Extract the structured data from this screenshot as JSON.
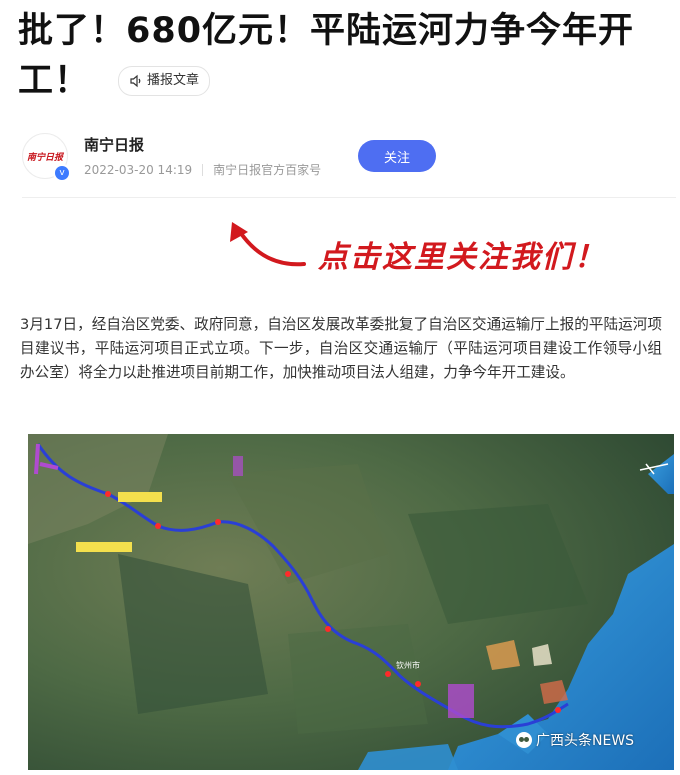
{
  "article": {
    "title_line1": "批了！680亿元！平陆运河力争今年开",
    "title_line2": "工！",
    "listen_label": "播报文章"
  },
  "author": {
    "name": "南宁日报",
    "avatar_text": "南宁日报",
    "date": "2022-03-20 14:19",
    "source": "南宁日报官方百家号",
    "follow_label": "关注",
    "verified_mark": "v"
  },
  "banner": {
    "text": "点击这里关注我们！"
  },
  "body": {
    "paragraph": "3月17日，经自治区党委、政府同意，自治区发展改革委批复了自治区交通运输厅上报的平陆运河项目建议书，平陆运河项目正式立项。下一步，自治区交通运输厅（平陆运河项目建设工作领导小组办公室）将全力以赴推进项目前期工作，加快推动项目法人组建，力争今年开工建设。"
  },
  "map": {
    "watermark": "广西头条NEWS",
    "city_label": "钦州市"
  },
  "colors": {
    "accent": "#4e6ef2",
    "banner_red": "#d2191e",
    "sea": "#2f8fd2",
    "route": "#2a3fd6"
  }
}
